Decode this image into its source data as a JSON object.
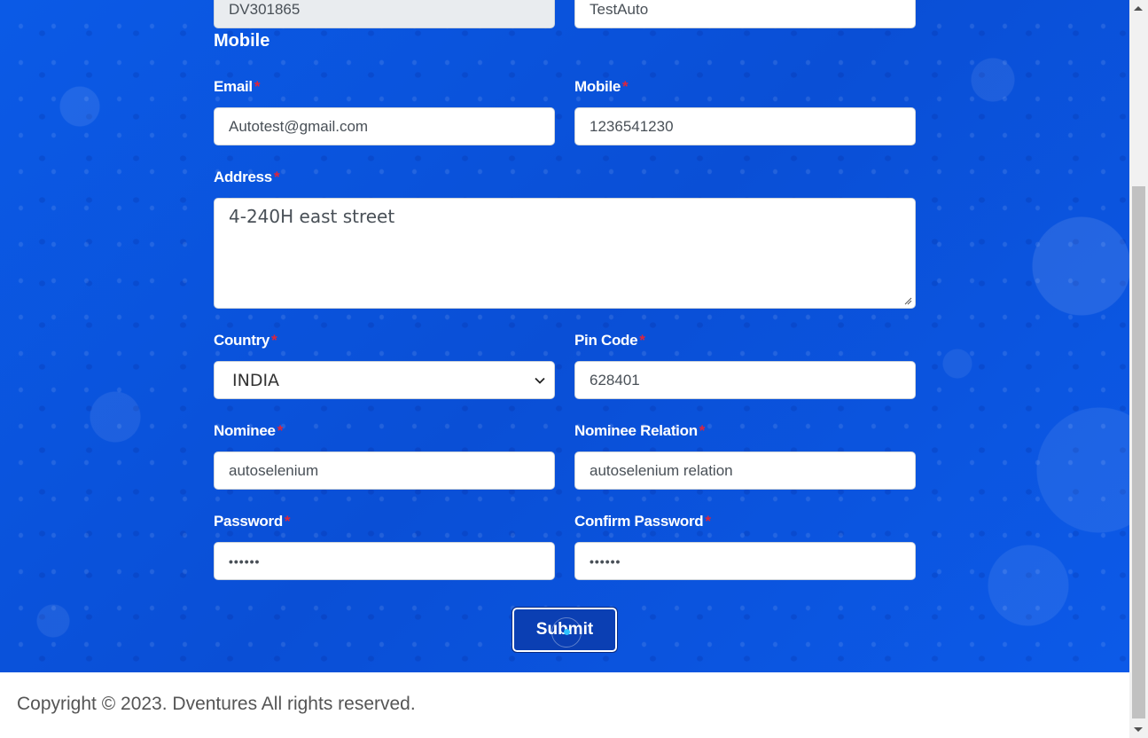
{
  "form": {
    "top_row": {
      "left_value": "DV301865",
      "right_value": "TestAuto"
    },
    "section_title": "Mobile",
    "email": {
      "label": "Email",
      "required_mark": "*",
      "value": "Autotest@gmail.com"
    },
    "mobile": {
      "label": "Mobile",
      "required_mark": "*",
      "value": "1236541230"
    },
    "address": {
      "label": "Address",
      "required_mark": "*",
      "value": "4-240H east street"
    },
    "country": {
      "label": "Country",
      "required_mark": "*",
      "selected": "INDIA"
    },
    "pin_code": {
      "label": "Pin Code",
      "required_mark": "*",
      "value": "628401"
    },
    "nominee": {
      "label": "Nominee",
      "required_mark": "*",
      "value": "autoselenium"
    },
    "nominee_relation": {
      "label": "Nominee Relation",
      "required_mark": "*",
      "value": "autoselenium relation"
    },
    "password": {
      "label": "Password",
      "required_mark": "*",
      "value": "••••••"
    },
    "confirm_password": {
      "label": "Confirm Password",
      "required_mark": "*",
      "value": "••••••"
    },
    "submit_label": "Submit"
  },
  "footer": {
    "copyright": "Copyright © 2023. Dventures All rights reserved."
  },
  "colors": {
    "background_blue": "#0a55e0",
    "required_red": "#e0243a",
    "submit_blue": "#0b3fb3"
  },
  "icons": {
    "select_arrow": "chevron-down-icon",
    "textarea_grip": "resize-grip-icon"
  }
}
